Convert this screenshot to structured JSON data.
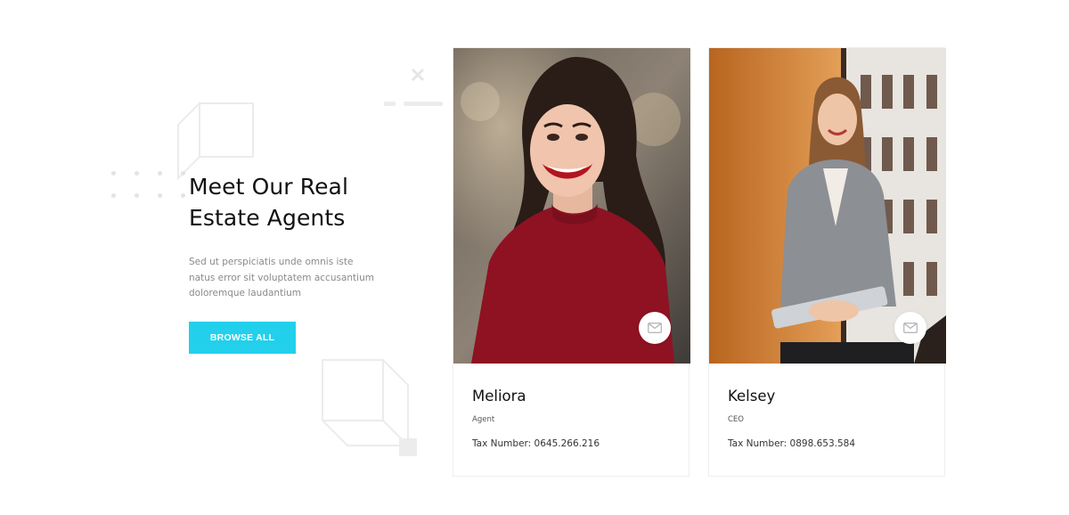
{
  "intro": {
    "title_line1": "Meet Our Real",
    "title_line2": "Estate Agents",
    "description": "Sed ut perspiciatis unde omnis iste natus error sit voluptatem accusantium doloremque laudantium",
    "button_label": "BROWSE ALL"
  },
  "colors": {
    "accent": "#22d0ec",
    "heading": "#111111",
    "muted": "#8a8a8a"
  },
  "agents": [
    {
      "name": "Meliora",
      "role": "Agent",
      "tax": "Tax Number: 0645.266.216",
      "contact_icon": "mail-icon"
    },
    {
      "name": "Kelsey",
      "role": "CEO",
      "tax": "Tax Number: 0898.653.584",
      "contact_icon": "mail-icon"
    }
  ]
}
